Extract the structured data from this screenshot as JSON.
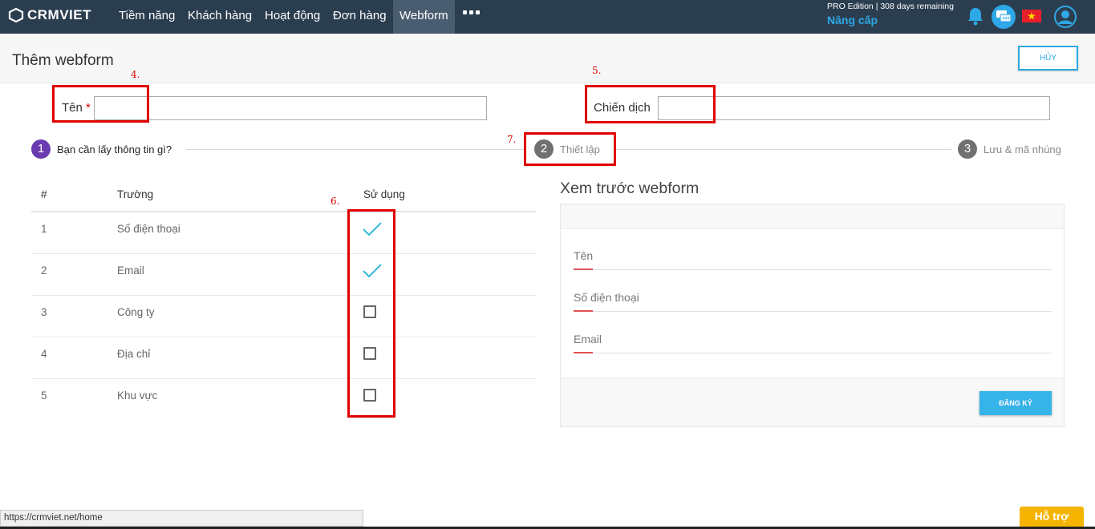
{
  "nav": {
    "logo": "CRMVIET",
    "items": [
      "Tiềm năng",
      "Khách hàng",
      "Hoạt động",
      "Đơn hàng",
      "Webform"
    ],
    "active_index": 4,
    "edition": "PRO Edition | 308 days remaining",
    "upgrade": "Nâng cấp",
    "icons": [
      "bell-icon",
      "chat-icon",
      "vietnam-flag-icon",
      "user-icon"
    ]
  },
  "header": {
    "title": "Thêm webform",
    "cancel_label": "HỦY"
  },
  "form": {
    "name_label": "Tên",
    "required_mark": "*",
    "campaign_label": "Chiến dịch",
    "name_value": "",
    "campaign_value": ""
  },
  "annotations": [
    "4.",
    "5.",
    "6.",
    "7."
  ],
  "steps": [
    {
      "number": "1",
      "label": "Bạn cần lấy thông tin gì?",
      "state": "active"
    },
    {
      "number": "2",
      "label": "Thiết lập",
      "state": "inactive"
    },
    {
      "number": "3",
      "label": "Lưu & mã nhúng",
      "state": "inactive"
    }
  ],
  "table": {
    "headers": [
      "#",
      "Trường",
      "Sử dụng"
    ],
    "rows": [
      {
        "index": "1",
        "field": "Số điện thoại",
        "used": true
      },
      {
        "index": "2",
        "field": "Email",
        "used": true
      },
      {
        "index": "3",
        "field": "Công ty",
        "used": false
      },
      {
        "index": "4",
        "field": "Địa chỉ",
        "used": false
      },
      {
        "index": "5",
        "field": "Khu vực",
        "used": false
      }
    ]
  },
  "preview": {
    "title": "Xem trước webform",
    "fields": [
      "Tên",
      "Số điện thoại",
      "Email"
    ],
    "submit_label": "ĐĂNG KÝ"
  },
  "status_bar": {
    "url": "https://crmviet.net/home"
  },
  "help": {
    "label": "Hỗ trợ"
  },
  "colors": {
    "nav_bg": "#2b3e50",
    "accent_blue": "#2ea8e6",
    "step_active": "#6a3ab0",
    "step_inactive": "#707070",
    "annotation_red": "#e00000",
    "check_color": "#35b8d8",
    "help_bg": "#f5b400"
  }
}
